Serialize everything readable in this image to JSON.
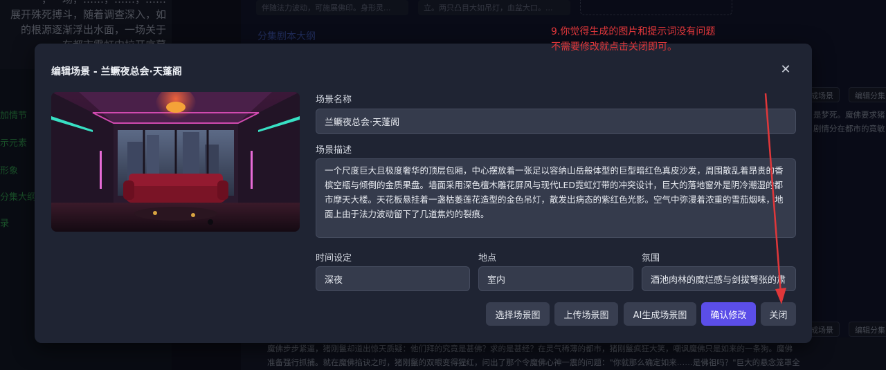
{
  "background": {
    "story_lines": [
      "，一场，……，……，……",
      "展开殊死搏斗，随着调查深入，如",
      "的根源逐渐浮出水面，一场关于",
      "在都市霓虹中拉开序幕"
    ],
    "nav_items": [
      "加情节",
      "示元素",
      "形象",
      "分集大纲",
      "录"
    ],
    "top_cards": [
      "伴随法力波动，可施展佛印。身形灵...",
      "立。两只凸目大如吊灯，血盆大口。..."
    ],
    "section_title": "分集剧本大纲",
    "tags_row1": [
      "成场景",
      "编辑分集"
    ],
    "tags_row2": [
      "成场景",
      "编辑分集"
    ],
    "side_text_1": [
      "是梦死。魔佛要求猪",
      "剧情分在都市的竟敏"
    ],
    "bottom_text_1": "魔佛步步紧逼，猪刚鬣却道出惊天质疑：他们拜的究竟是甚佛？求的是甚经？在灵气稀薄的都市，猪刚鬣疯狂大笑，嘲讽魔佛只是如来的一条狗。魔佛",
    "bottom_text_2": "准备强行抓捕。就在魔佛掐诀之时，猪刚鬣的双眼变得猩红，问出了那个令魔佛心神一震的问题：\"你就那么确定如来……是佛祖吗？\"巨大的悬念笼罩全"
  },
  "modal": {
    "title": "编辑场景 - 兰鳜夜总会·天蓬阁",
    "close_symbol": "✕",
    "scene_name_label": "场景名称",
    "scene_name_value": "兰鳜夜总会·天蓬阁",
    "scene_desc_label": "场景描述",
    "scene_desc_value": "一个尺度巨大且极度奢华的顶层包厢，中心摆放着一张足以容纳山岳般体型的巨型暗红色真皮沙发，周围散乱着昂贵的香槟空瓶与倾倒的金质果盘。墙面采用深色檀木雕花屏风与现代LED霓虹灯带的冲突设计，巨大的落地窗外是阴冷潮湿的都市摩天大楼。天花板悬挂着一盏枯萎莲花造型的金色吊灯，散发出病态的紫红色光影。空气中弥漫着浓重的雪茄烟味，地面上由于法力波动留下了几道焦灼的裂痕。",
    "time_label": "时间设定",
    "time_value": "深夜",
    "location_label": "地点",
    "location_value": "室内",
    "atmosphere_label": "氛围",
    "atmosphere_value": "酒池肉林的糜烂感与剑拔弩张的肃",
    "buttons": {
      "select": "选择场景图",
      "upload": "上传场景图",
      "ai": "AI生成场景图",
      "confirm": "确认修改",
      "close": "关闭"
    }
  },
  "annotation": {
    "line1": "9.你觉得生成的图片和提示词没有问题",
    "line2": "不需要修改就点击关闭即可。"
  },
  "colors": {
    "accent": "#5b4ee8",
    "annotation": "#e0373a",
    "modal_bg": "#1f2433",
    "input_bg": "#353b4c"
  },
  "icons": {
    "close": "close-icon"
  }
}
